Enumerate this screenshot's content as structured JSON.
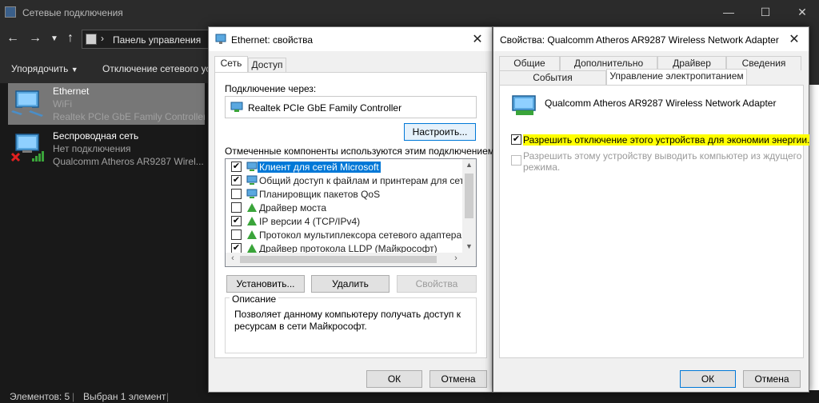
{
  "explorer": {
    "title": "Сетевые подключения",
    "address": "Панель управления",
    "commands": {
      "organize": "Упорядочить",
      "disable": "Отключение сетевого ус"
    },
    "adapters": [
      {
        "name": "Ethernet",
        "sub": "WiFi",
        "device": "Realtek PCIe GbE Family Controller"
      },
      {
        "name": "Беспроводная сеть",
        "sub": "Нет подключения",
        "device": "Qualcomm Atheros AR9287 Wirel..."
      }
    ],
    "status": {
      "count": "Элементов: 5",
      "selected": "Выбран 1 элемент"
    }
  },
  "eth_dialog": {
    "title": "Ethernet: свойства",
    "tabs": [
      "Сеть",
      "Доступ"
    ],
    "connect_using_label": "Подключение через:",
    "adapter": "Realtek PCIe GbE Family Controller",
    "configure": "Настроить...",
    "components_label": "Отмеченные компоненты используются этим подключением:",
    "components": [
      {
        "label": "Клиент для сетей Microsoft",
        "checked": "✔"
      },
      {
        "label": "Общий доступ к файлам и принтерам для сетей Mi",
        "checked": "✔"
      },
      {
        "label": "Планировщик пакетов QoS",
        "checked": ""
      },
      {
        "label": "Драйвер моста",
        "checked": ""
      },
      {
        "label": "IP версии 4 (TCP/IPv4)",
        "checked": "✔"
      },
      {
        "label": "Протокол мультиплексора сетевого адаптера (Май",
        "checked": ""
      },
      {
        "label": "Драйвер протокола LLDP (Майкрософт)",
        "checked": "✔"
      }
    ],
    "install": "Установить...",
    "remove": "Удалить",
    "properties": "Свойства",
    "description_label": "Описание",
    "description": "Позволяет данному компьютеру получать доступ к ресурсам в сети Майкрософт.",
    "ok": "ОК",
    "cancel": "Отмена"
  },
  "qc_dialog": {
    "title": "Свойства: Qualcomm Atheros AR9287 Wireless Network Adapter",
    "tabs_row1": [
      "Общие",
      "Дополнительно",
      "Драйвер",
      "Сведения"
    ],
    "tabs_row2": [
      "События",
      "Управление электропитанием"
    ],
    "device": "Qualcomm Atheros AR9287 Wireless Network Adapter",
    "allow_off": "Разрешить отключение этого устройства для экономии энергии.",
    "allow_off_checked": "✔",
    "allow_wake_line1": "Разрешить этому устройству выводить компьютер из ждущего",
    "allow_wake_line2": "режима.",
    "ok": "ОК",
    "cancel": "Отмена"
  }
}
